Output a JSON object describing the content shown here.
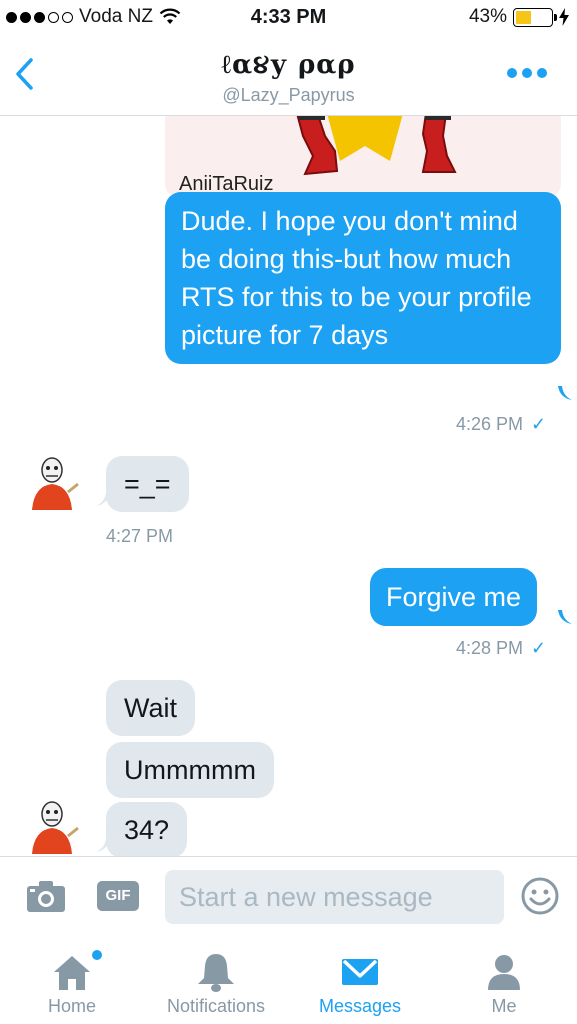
{
  "status_bar": {
    "carrier": "Voda NZ",
    "time": "4:33 PM",
    "battery": "43%",
    "battery_level": 0.43,
    "signal_bars_filled": 3,
    "signal_bars_total": 5
  },
  "header": {
    "back_icon": "chevron-left-icon",
    "title": "ℓα૪у ραρ",
    "handle": "@Lazy_Papyrus",
    "more_icon": "more-dots-icon"
  },
  "conversation": {
    "image_message": {
      "watermark": "AniiTaRuiz"
    },
    "messages": [
      {
        "direction": "out",
        "text": "Dude. I hope you don't mind be doing this-but how much RTS for this to be your profile picture for 7 days"
      },
      {
        "direction": "out",
        "timestamp": "4:26 PM",
        "read": "✓"
      },
      {
        "direction": "in",
        "text": "=_="
      },
      {
        "direction": "in",
        "timestamp": "4:27 PM"
      },
      {
        "direction": "out",
        "text": "Forgive me"
      },
      {
        "direction": "out",
        "timestamp": "4:28 PM",
        "read": "✓"
      },
      {
        "direction": "in",
        "text": "Wait"
      },
      {
        "direction": "in",
        "text": "Ummmmm"
      },
      {
        "direction": "in",
        "text": "34?"
      }
    ]
  },
  "composer": {
    "camera_icon": "camera-icon",
    "gif_label": "GIF",
    "placeholder": "Start a new message",
    "emoji_icon": "smiley-icon"
  },
  "tabs": [
    {
      "label": "Home",
      "icon": "home-icon",
      "active": false,
      "badge": true
    },
    {
      "label": "Notifications",
      "icon": "bell-icon",
      "active": false
    },
    {
      "label": "Messages",
      "icon": "envelope-icon",
      "active": true
    },
    {
      "label": "Me",
      "icon": "person-icon",
      "active": false
    }
  ],
  "colors": {
    "accent": "#1da1f2",
    "incoming_bubble": "#e1e8ed",
    "muted_text": "#8899a6",
    "battery_fill": "#f5c518"
  }
}
